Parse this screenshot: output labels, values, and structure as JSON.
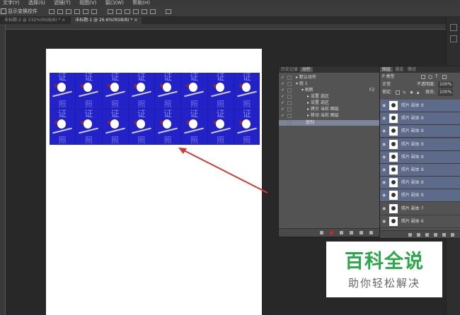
{
  "menubar": {
    "items": [
      "文字(Y)",
      "选择(S)",
      "滤镜(T)",
      "视图(V)",
      "窗口(W)",
      "帮助(H)"
    ]
  },
  "options_bar": {
    "label": "显示变换控件"
  },
  "tabs": [
    {
      "label": "未标题-2 @ 232%(RGB/8) *"
    },
    {
      "label": "未标题-1 @ 26.6%(RGB/8) *"
    }
  ],
  "canvas": {
    "cell_top_char": "证",
    "cell_bottom_char": "照"
  },
  "actions_panel": {
    "tabs": [
      "历史记录",
      "动作"
    ],
    "active_tab": "动作",
    "rows": [
      {
        "check": "✓",
        "text": "▸ 默认动作"
      },
      {
        "check": "✓",
        "text": "▾ 组 1"
      },
      {
        "check": "✓",
        "text": "▾ 刷新",
        "shortcut": "F2"
      },
      {
        "check": "✓",
        "text": "▸ 设置 选区"
      },
      {
        "check": "✓",
        "text": "▸ 设置 选区"
      },
      {
        "check": "✓",
        "text": "▸ 拷贝 当前 图层"
      },
      {
        "check": "✓",
        "text": "▸ 移动 当前 图层"
      },
      {
        "check": "",
        "text": "复制"
      }
    ]
  },
  "layers_panel": {
    "tabs": [
      "图层",
      "通道",
      "路径"
    ],
    "active_tab": "图层",
    "filter_label": "P 类型",
    "blend_mode": "正常",
    "opacity_label": "不透明度:",
    "opacity_value": "100%",
    "lock_label": "锁定:",
    "fill_label": "填充:",
    "fill_value": "100%",
    "layers": [
      {
        "name": "照片 副本 8",
        "selected": true
      },
      {
        "name": "照片 副本 8",
        "selected": true
      },
      {
        "name": "照片 副本 8",
        "selected": true
      },
      {
        "name": "照片 副本 8",
        "selected": true
      },
      {
        "name": "照片 副本 8",
        "selected": true
      },
      {
        "name": "照片 副本 8",
        "selected": true
      },
      {
        "name": "照片 副本 8",
        "selected": true
      },
      {
        "name": "照片 副本 8",
        "selected": true
      },
      {
        "name": "照片 副本 7",
        "selected": false
      },
      {
        "name": "照片 副本 6",
        "selected": false
      }
    ]
  },
  "watermark": {
    "title": "百科全说",
    "subtitle": "助你轻松解决"
  },
  "colors": {
    "selection": "#5d6a8a",
    "canvas_blue": "#2222c8",
    "annotation_arrow": "#d23a3a",
    "watermark_green": "#2aa84a"
  }
}
